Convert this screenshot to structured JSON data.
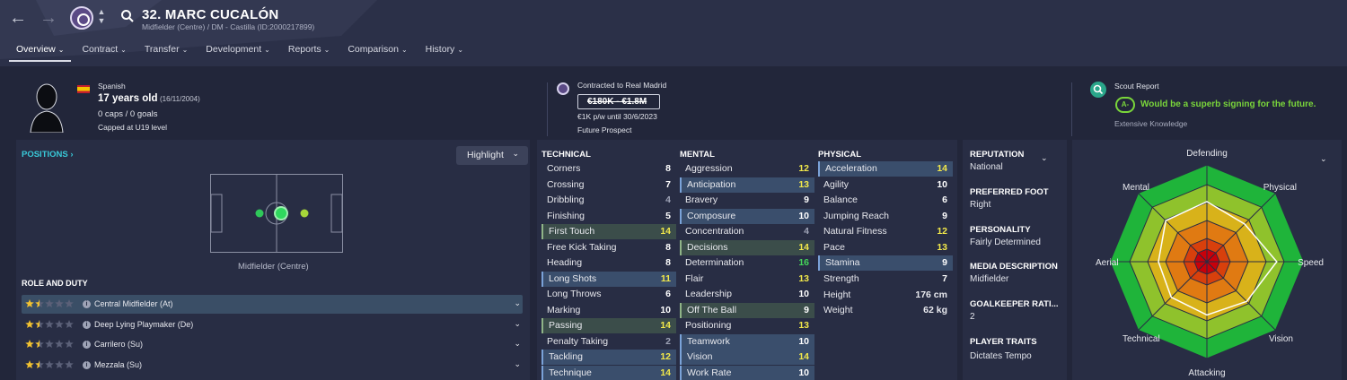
{
  "header": {
    "title": "32. MARC CUCALÓN",
    "subtitle": "Midfielder (Centre) / DM - Castilla (ID:2000217899)"
  },
  "tabs": [
    {
      "label": "Overview"
    },
    {
      "label": "Contract"
    },
    {
      "label": "Transfer"
    },
    {
      "label": "Development"
    },
    {
      "label": "Reports"
    },
    {
      "label": "Comparison"
    },
    {
      "label": "History"
    }
  ],
  "info": {
    "nationality": "Spanish",
    "age": "17 years old",
    "dob": "(16/11/2004)",
    "caps": "0 caps / 0 goals",
    "capped": "Capped at U19 level",
    "contracted": "Contracted to Real Madrid",
    "value": "€180K - €1.8M",
    "wage": "€1K p/w until 30/6/2023",
    "prospect": "Future Prospect",
    "scout_title": "Scout Report",
    "scout_grade": "A-",
    "scout_text": "Would be a superb signing for the future.",
    "scout_knowledge": "Extensive Knowledge"
  },
  "positions": {
    "title": "POSITIONS",
    "highlight": "Highlight",
    "position_label": "Midfielder (Centre)"
  },
  "roles": {
    "title": "ROLE AND DUTY",
    "items": [
      {
        "name": "Central Midfielder (At)",
        "stars": 1.5
      },
      {
        "name": "Deep Lying Playmaker (De)",
        "stars": 1.5
      },
      {
        "name": "Carrilero (Su)",
        "stars": 1.5
      },
      {
        "name": "Mezzala (Su)",
        "stars": 1.5
      }
    ]
  },
  "technical": {
    "title": "TECHNICAL",
    "items": [
      {
        "name": "Corners",
        "value": "8"
      },
      {
        "name": "Crossing",
        "value": "7"
      },
      {
        "name": "Dribbling",
        "value": "4"
      },
      {
        "name": "Finishing",
        "value": "5"
      },
      {
        "name": "First Touch",
        "value": "14"
      },
      {
        "name": "Free Kick Taking",
        "value": "8"
      },
      {
        "name": "Heading",
        "value": "8"
      },
      {
        "name": "Long Shots",
        "value": "11"
      },
      {
        "name": "Long Throws",
        "value": "6"
      },
      {
        "name": "Marking",
        "value": "10"
      },
      {
        "name": "Passing",
        "value": "14"
      },
      {
        "name": "Penalty Taking",
        "value": "2"
      },
      {
        "name": "Tackling",
        "value": "12"
      },
      {
        "name": "Technique",
        "value": "14"
      }
    ]
  },
  "mental": {
    "title": "MENTAL",
    "items": [
      {
        "name": "Aggression",
        "value": "12"
      },
      {
        "name": "Anticipation",
        "value": "13"
      },
      {
        "name": "Bravery",
        "value": "9"
      },
      {
        "name": "Composure",
        "value": "10"
      },
      {
        "name": "Concentration",
        "value": "4"
      },
      {
        "name": "Decisions",
        "value": "14"
      },
      {
        "name": "Determination",
        "value": "16"
      },
      {
        "name": "Flair",
        "value": "13"
      },
      {
        "name": "Leadership",
        "value": "10"
      },
      {
        "name": "Off The Ball",
        "value": "9"
      },
      {
        "name": "Positioning",
        "value": "13"
      },
      {
        "name": "Teamwork",
        "value": "10"
      },
      {
        "name": "Vision",
        "value": "14"
      },
      {
        "name": "Work Rate",
        "value": "10"
      }
    ]
  },
  "physical": {
    "title": "PHYSICAL",
    "items": [
      {
        "name": "Acceleration",
        "value": "14"
      },
      {
        "name": "Agility",
        "value": "10"
      },
      {
        "name": "Balance",
        "value": "6"
      },
      {
        "name": "Jumping Reach",
        "value": "9"
      },
      {
        "name": "Natural Fitness",
        "value": "12"
      },
      {
        "name": "Pace",
        "value": "13"
      },
      {
        "name": "Stamina",
        "value": "9"
      },
      {
        "name": "Strength",
        "value": "7"
      }
    ],
    "height_label": "Height",
    "height": "176 cm",
    "weight_label": "Weight",
    "weight": "62 kg"
  },
  "details": {
    "reputation_h": "REPUTATION",
    "reputation": "National",
    "foot_h": "PREFERRED FOOT",
    "foot": "Right",
    "personality_h": "PERSONALITY",
    "personality": "Fairly Determined",
    "media_h": "MEDIA DESCRIPTION",
    "media": "Midfielder",
    "gk_h": "GOALKEEPER RATI...",
    "gk": "2",
    "traits_h": "PLAYER TRAITS",
    "traits": "Dictates Tempo"
  },
  "radar": {
    "labels": [
      "Defending",
      "Physical",
      "Speed",
      "Vision",
      "Attacking",
      "Technical",
      "Aerial",
      "Mental"
    ]
  },
  "colors": {
    "bg": "#22263a",
    "panel": "#282d44",
    "accent_cyan": "#39c9d8",
    "scout_green": "#7ad63a",
    "value_yellow": "#f2e84a",
    "value_green": "#45d65a",
    "value_white": "#ffffff",
    "value_grey": "#9ea3b6"
  }
}
